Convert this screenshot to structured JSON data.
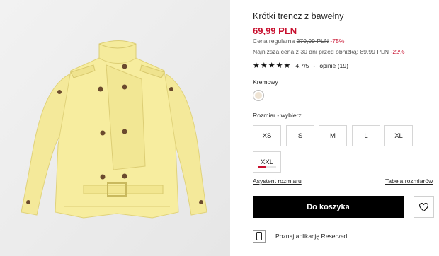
{
  "product": {
    "image_alt": "Krótki trencz z bawełny",
    "title": "Krótki trencz z bawełny",
    "price": "69,99 PLN",
    "regular_label": "Cena regularna",
    "regular_price": "279,99 PLN",
    "regular_discount": "-75%",
    "lowest_label": "Najniższa cena z 30 dni przed obniżką:",
    "lowest_price": "89,99 PLN",
    "lowest_discount": "-22%",
    "rating_stars": 5,
    "rating_value": "4,7/5",
    "rating_separator": "-",
    "reviews_link": "opinie (19)"
  },
  "color": {
    "name": "Kremowy",
    "swatch_hex": "#efe4d4"
  },
  "sizes": {
    "label": "Rozmiar -",
    "hint": "wybierz",
    "options": [
      "XS",
      "S",
      "M",
      "L",
      "XL",
      "XXL"
    ],
    "low_stock_fraction": 0.45
  },
  "links": {
    "size_assistant": "Asystent rozmiaru",
    "size_table": "Tabela rozmiarów"
  },
  "actions": {
    "add_to_cart": "Do koszyka"
  },
  "app_promo": {
    "text": "Poznaj aplikację Reserved"
  },
  "colors": {
    "accent_red": "#c8102e",
    "coat_yellow": "#f6ec9e",
    "button_black": "#000000"
  }
}
